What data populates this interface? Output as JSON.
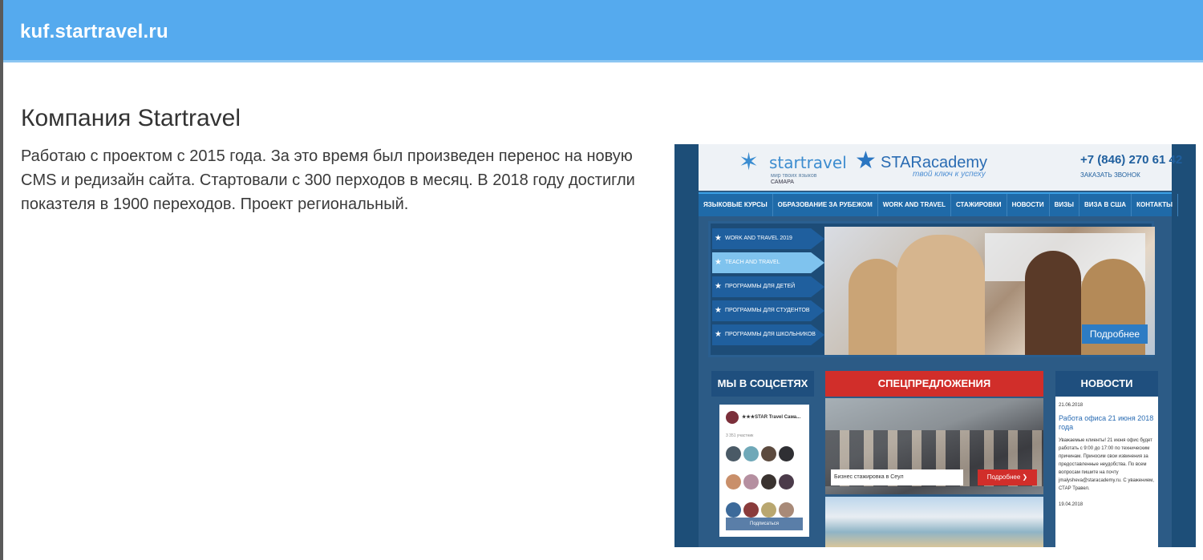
{
  "header": {
    "site": "kuf.startravel.ru"
  },
  "main": {
    "title": "Компания Startravel",
    "description": "Работаю с проектом с 2015 года. За это время был произведен перенос на новую CMS и редизайн сайта. Стартовали с 300 перходов в месяц. В 2018 году достигли показтеля в 1900 переходов. Проект региональный."
  },
  "screenshot": {
    "logo_startravel": "startravel",
    "logo_startravel_sub": "мир твоих языков",
    "logo_city": "САМАРА",
    "logo_staracademy": "STARacademy",
    "logo_staracademy_sub": "твой ключ к успеху",
    "phone": "+7 (846) 270 61 42",
    "callback": "ЗАКАЗАТЬ ЗВОНОК",
    "menu": [
      "ЯЗЫКОВЫЕ КУРСЫ",
      "ОБРАЗОВАНИЕ ЗА РУБЕЖОМ",
      "WORK AND TRAVEL",
      "СТАЖИРОВКИ",
      "НОВОСТИ",
      "ВИЗЫ",
      "ВИЗА В США",
      "КОНТАКТЫ"
    ],
    "programs": [
      "WORK AND TRAVEL 2019",
      "TEACH AND TRAVEL",
      "ПРОГРАММЫ ДЛЯ ДЕТЕЙ",
      "ПРОГРАММЫ ДЛЯ СТУДЕНТОВ",
      "ПРОГРАММЫ ДЛЯ ШКОЛЬНИКОВ"
    ],
    "banner_button": "Подробнее",
    "social_title": "МЫ В СОЦСЕТЯХ",
    "social_group": "★★★STAR Travel Сама...",
    "social_count": "3 351 участник",
    "social_subscribe": "Подписаться",
    "special_title": "СПЕЦПРЕДЛОЖЕНИЯ",
    "special_caption": "Бизнес стажировка в Сеул",
    "special_button": "Подробнее ❯",
    "news_title": "НОВОСТИ",
    "news_date": "21.06.2018",
    "news_headline": "Работа офиса 21 июня 2018 года",
    "news_body": "Уважаемые клиенты! 21 июня офис будет работать с 9:00 до 17:00 по техническим причинам. Приносим свои извинения за предоставленные неудобства. По всем вопросам пишите на почту jmalysheva@staracademy.ru. С уважением, СТАР Травел.",
    "news_date2": "19.04.2018"
  }
}
